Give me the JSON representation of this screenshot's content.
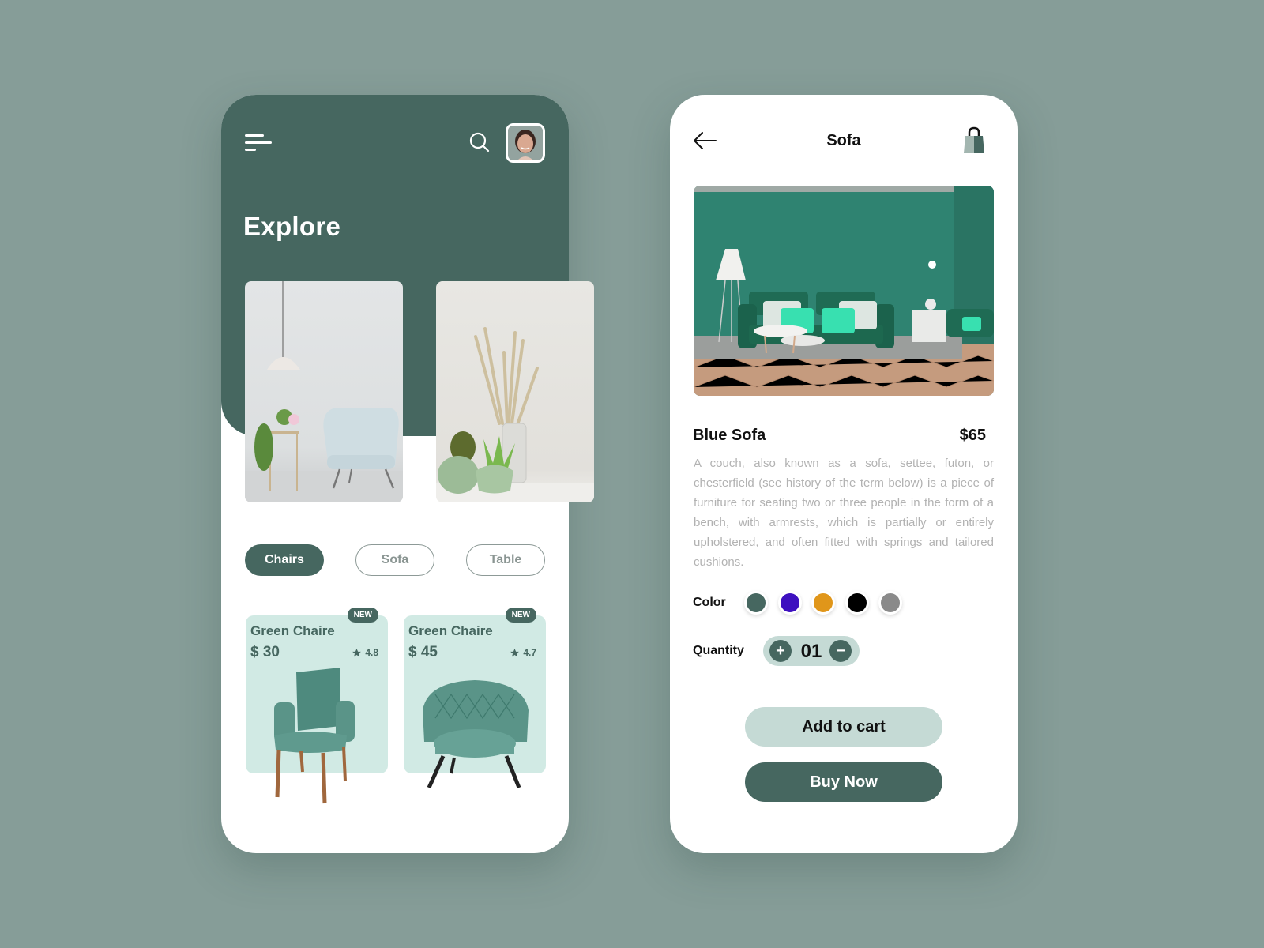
{
  "explore_screen": {
    "header": {
      "menu_icon": "menu-icon",
      "search_icon": "search-icon",
      "avatar": "user-avatar"
    },
    "title": "Explore",
    "featured_images": [
      {
        "name": "armchair-room-photo"
      },
      {
        "name": "plants-vases-photo"
      }
    ],
    "categories": [
      {
        "label": "Chairs",
        "active": true
      },
      {
        "label": "Sofa",
        "active": false
      },
      {
        "label": "Table",
        "active": false
      }
    ],
    "products": [
      {
        "badge": "NEW",
        "name": "Green Chaire",
        "price": "$ 30",
        "rating": "4.8"
      },
      {
        "badge": "NEW",
        "name": "Green Chaire",
        "price": "$ 45",
        "rating": "4.7"
      }
    ]
  },
  "detail_screen": {
    "header": {
      "back_icon": "arrow-left-icon",
      "title": "Sofa",
      "bag_icon": "shopping-bag-icon"
    },
    "product": {
      "name": "Blue Sofa",
      "price": "$65",
      "description": "A couch, also known as a sofa, settee, futon, or chesterfield (see history of the term below) is a piece of furniture for seating two or three people in the form of a bench, with armrests, which is partially or entirely upholstered, and often fitted with springs and tailored cushions."
    },
    "color_label": "Color",
    "colors": [
      "#466760",
      "#3d10bf",
      "#e0961a",
      "#000000",
      "#8a8a8a"
    ],
    "quantity_label": "Quantity",
    "quantity": {
      "plus": "+",
      "value": "01",
      "minus": "−"
    },
    "add_to_cart_label": "Add to cart",
    "buy_now_label": "Buy Now"
  },
  "theme": {
    "primary": "#466760",
    "light": "#c5dad5",
    "card_bg": "#d1eae4",
    "background": "#869d98"
  }
}
